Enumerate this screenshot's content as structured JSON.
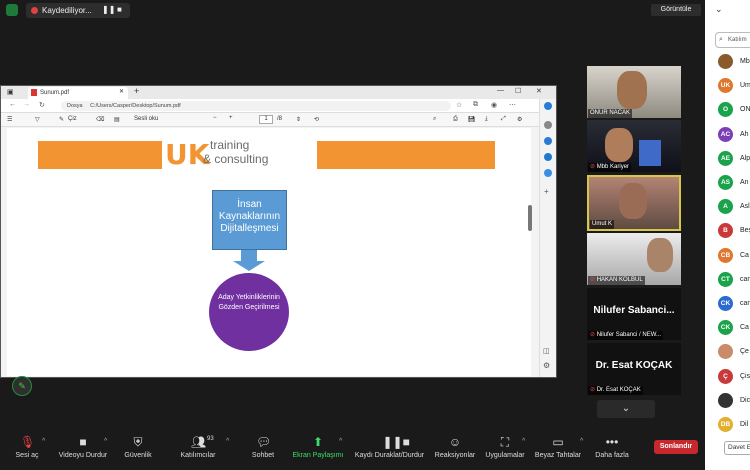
{
  "topbar": {
    "recording_label": "Kaydediliyor...",
    "pause_icon": "pause-icon",
    "stop_icon": "stop-icon",
    "view_label": "Görüntüle"
  },
  "browser": {
    "tab_title": "Sunum.pdf",
    "new_tab": "+",
    "url_prefix": "Dosya",
    "url": "C:/Users/Casper/Desktop/Sunum.pdf",
    "toolbar": {
      "draw_label": "Çiz",
      "read_aloud": "Sesli oku",
      "page_current": "1",
      "page_total": "/8",
      "zoom_out": "−",
      "zoom_in": "+"
    }
  },
  "slide": {
    "logo_mark": "UK",
    "logo_line1": "training",
    "logo_line2": "& consulting",
    "box_text": "İnsan Kaynaklarının Dijitalleşmesi",
    "circle_text": "Aday Yetkinliklerinin Gözden Geçirilmesi",
    "colors": {
      "orange": "#f39433",
      "blue": "#5b9bd5",
      "purple": "#7030a0"
    }
  },
  "videos": [
    {
      "name": "ONUR NACAK",
      "type": "camera"
    },
    {
      "name": "Mbb Kariyer",
      "type": "camera",
      "muted": true
    },
    {
      "name": "Umut K",
      "type": "camera",
      "active": true
    },
    {
      "name": "HAKAN KOLBUL",
      "type": "camera",
      "muted": true
    },
    {
      "name": "Nilufer Sabanci / NEW...",
      "big_name": "Nilufer Sabanci...",
      "type": "name",
      "muted": true
    },
    {
      "name": "Dr. Esat KOÇAK",
      "big_name": "Dr. Esat KOÇAK",
      "type": "name",
      "muted": true
    }
  ],
  "participants_panel": {
    "search_placeholder": "Katılım",
    "close": "⌄",
    "items": [
      {
        "initials": "",
        "name": "Mb",
        "color": "#8a5a2a"
      },
      {
        "initials": "UK",
        "name": "Um",
        "color": "#e0772e"
      },
      {
        "initials": "O",
        "name": "ON",
        "color": "#1aa34a"
      },
      {
        "initials": "AC",
        "name": "Ah",
        "color": "#7b3fb5"
      },
      {
        "initials": "AE",
        "name": "Alp",
        "color": "#1aa34a"
      },
      {
        "initials": "AS",
        "name": "An",
        "color": "#1aa34a"
      },
      {
        "initials": "A",
        "name": "Asl",
        "color": "#1aa34a"
      },
      {
        "initials": "B",
        "name": "Beş",
        "color": "#c83a3a"
      },
      {
        "initials": "CB",
        "name": "Ca",
        "color": "#e0772e"
      },
      {
        "initials": "CT",
        "name": "can",
        "color": "#1aa34a"
      },
      {
        "initials": "CK",
        "name": "can",
        "color": "#2a6ad1"
      },
      {
        "initials": "CK",
        "name": "Ca",
        "color": "#1aa34a"
      },
      {
        "initials": "",
        "name": "Çe",
        "color": "#c98b6a"
      },
      {
        "initials": "Ç",
        "name": "Çis",
        "color": "#c83a3a"
      },
      {
        "initials": "",
        "name": "Dic",
        "color": "#333"
      },
      {
        "initials": "DB",
        "name": "Dil",
        "color": "#e0b02e"
      }
    ],
    "invite_label": "Davet Et"
  },
  "bottom_toolbar": {
    "items": [
      {
        "label": "Sesi aç",
        "icon": "mic-muted-icon"
      },
      {
        "label": "Videoyu Durdur",
        "icon": "camera-icon"
      },
      {
        "label": "Güvenlik",
        "icon": "shield-icon"
      },
      {
        "label": "Katılımcılar",
        "icon": "participants-icon",
        "count": "93"
      },
      {
        "label": "Sohbet",
        "icon": "chat-icon"
      },
      {
        "label": "Ekran Paylaşımı",
        "icon": "share-screen-icon"
      },
      {
        "label": "Kaydı Duraklat/Durdur",
        "icon": "record-icon"
      },
      {
        "label": "Reaksiyonlar",
        "icon": "reaction-icon"
      },
      {
        "label": "Uygulamalar",
        "icon": "apps-icon"
      },
      {
        "label": "Beyaz Tahtalar",
        "icon": "whiteboard-icon"
      },
      {
        "label": "Daha fazla",
        "icon": "more-icon"
      }
    ],
    "end_label": "Sonlandır"
  }
}
